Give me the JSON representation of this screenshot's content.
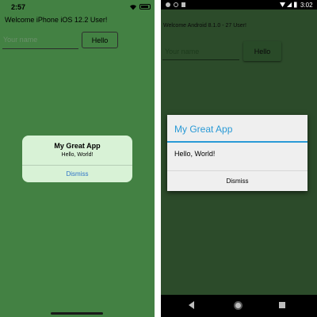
{
  "ios": {
    "status_time": "2:57",
    "welcome_text": "Welcome iPhone iOS 12.2 User!",
    "name_placeholder": "Your name",
    "hello_button_label": "Hello",
    "alert": {
      "title": "My Great App",
      "message": "Hello, World!",
      "dismiss_label": "Dismiss"
    },
    "icons": {
      "wifi": "wifi-icon",
      "battery": "battery-icon"
    }
  },
  "android": {
    "status_time": "3:02",
    "welcome_text": "Welcome Android 8.1.0 - 27 User!",
    "name_placeholder": "Your name",
    "hello_button_label": "Hello",
    "dialog": {
      "title": "My Great App",
      "message": "Hello, World!",
      "dismiss_label": "Dismiss"
    },
    "icons": {
      "back": "back-icon",
      "home": "home-icon",
      "recents": "recents-icon"
    }
  },
  "colors": {
    "ios_background": "#438143",
    "ios_alert_background": "#d8f2d6",
    "ios_alert_action": "#2f74c8",
    "android_background": "#2c4b2a",
    "android_dialog_accent": "#2a9ad6"
  }
}
